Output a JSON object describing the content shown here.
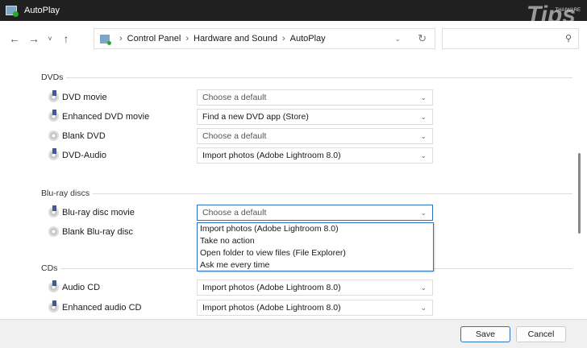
{
  "window": {
    "title": "AutoPlay",
    "watermark": "Tips",
    "watermark_small": "THAIWARE"
  },
  "nav": {
    "back": "←",
    "forward": "→",
    "recent": "˅",
    "up": "↑",
    "breadcrumb": [
      "Control Panel",
      "Hardware and Sound",
      "AutoPlay"
    ],
    "search_placeholder": ""
  },
  "sections": {
    "dvds": {
      "title": "DVDs",
      "items": [
        {
          "label": "DVD movie",
          "value": "Choose a default"
        },
        {
          "label": "Enhanced DVD movie",
          "value": "Find a new DVD app (Store)"
        },
        {
          "label": "Blank DVD",
          "value": "Choose a default"
        },
        {
          "label": "DVD-Audio",
          "value": "Import photos (Adobe Lightroom 8.0)"
        }
      ]
    },
    "bluray": {
      "title": "Blu-ray discs",
      "items": [
        {
          "label": "Blu-ray disc movie",
          "value": "Choose a default"
        },
        {
          "label": "Blank Blu-ray disc",
          "value": ""
        }
      ]
    },
    "cds": {
      "title": "CDs",
      "items": [
        {
          "label": "Audio CD",
          "value": "Import photos (Adobe Lightroom 8.0)"
        },
        {
          "label": "Enhanced audio CD",
          "value": "Import photos (Adobe Lightroom 8.0)"
        }
      ]
    }
  },
  "dropdown_options": [
    "Import photos (Adobe Lightroom 8.0)",
    "Take no action",
    "Open folder to view files (File Explorer)",
    "Ask me every time"
  ],
  "footer": {
    "save": "Save",
    "cancel": "Cancel"
  }
}
